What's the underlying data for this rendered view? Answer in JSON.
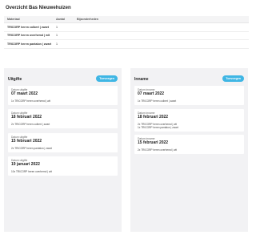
{
  "title": "Overzicht Bas Nieuwehuizen",
  "table": {
    "headers": [
      "Materiaal",
      "Aantal",
      "Bijzonderheden"
    ],
    "rows": [
      {
        "materiaal": "TRICORP heren colbert | zwart",
        "aantal": "1",
        "bijzonderheden": ""
      },
      {
        "materiaal": "TRICORP heren overhemd | wit",
        "aantal": "1",
        "bijzonderheden": ""
      },
      {
        "materiaal": "TRICORP heren pantalon | zwart",
        "aantal": "1",
        "bijzonderheden": ""
      }
    ]
  },
  "uitgifte": {
    "title": "Uitgifte",
    "button": "Toevoegen",
    "entries": [
      {
        "label": "Datum uitgifte",
        "date": "07 maart 2022",
        "items": [
          "1x TRICORP heren overhemd | wit"
        ]
      },
      {
        "label": "Datum uitgifte",
        "date": "18 februari 2022",
        "items": [
          "2x TRICORP heren colbert | zwart"
        ]
      },
      {
        "label": "Datum uitgifte",
        "date": "15 februari 2022",
        "items": [
          "2x TRICORP heren pantalon | zwart"
        ]
      },
      {
        "label": "Datum uitgifte",
        "date": "19 januari 2022",
        "items": [
          "10x TRICORP heren overhemd | wit"
        ]
      }
    ]
  },
  "inname": {
    "title": "Inname",
    "button": "Toevoegen",
    "entries": [
      {
        "label": "Datum inname",
        "date": "07 maart 2022",
        "items": [
          "1x TRICORP heren colbert | zwart"
        ]
      },
      {
        "label": "Datum inname",
        "date": "18 februari 2022",
        "items": [
          "2x TRICORP heren overhemd | wit",
          "1x TRICORP heren pantalon | zwart"
        ]
      },
      {
        "label": "Datum inname",
        "date": "15 februari 2022",
        "items": [
          "2x TRICORP heren overhemd | wit"
        ]
      }
    ]
  }
}
